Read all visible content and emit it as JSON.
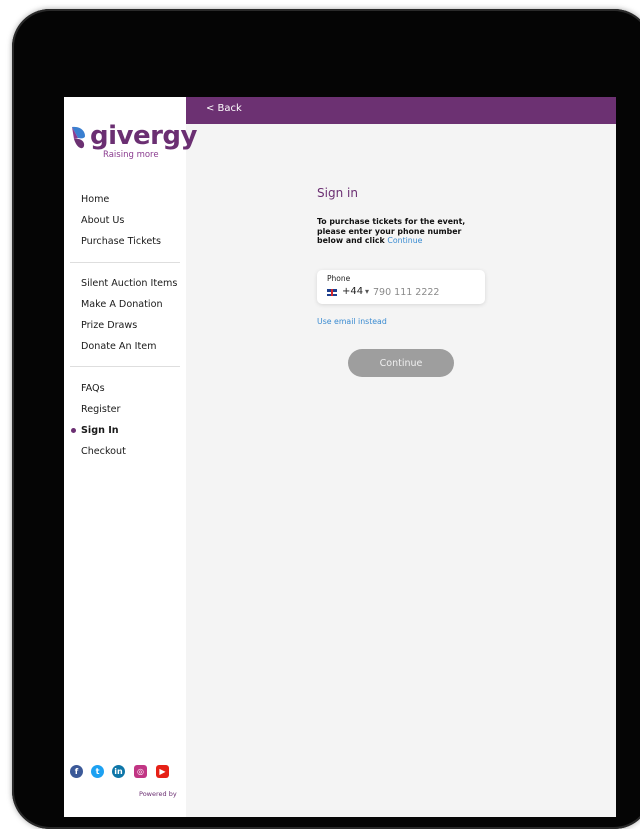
{
  "brand": {
    "name": "givergy",
    "tagline": "Raising more",
    "purple": "#6c3172",
    "logo_blue": "#3a7fd0"
  },
  "topbar": {
    "back_label": "< Back"
  },
  "sidebar": {
    "groups": [
      [
        "Home",
        "About Us",
        "Purchase Tickets"
      ],
      [
        "Silent Auction Items",
        "Make A Donation",
        "Prize Draws",
        "Donate An Item"
      ],
      [
        "FAQs",
        "Register",
        "Sign In",
        "Checkout"
      ]
    ],
    "active_item": "Sign In",
    "social_icons": [
      "facebook-icon",
      "twitter-icon",
      "linkedin-icon",
      "instagram-icon",
      "youtube-icon"
    ],
    "powered_by": "Powered by"
  },
  "signin": {
    "title": "Sign in",
    "instruction": "To purchase tickets for the event, please enter your phone number below and click",
    "instruction_link": "Continue",
    "phone_label": "Phone",
    "country_code": "+44",
    "phone_placeholder": "790 111 2222",
    "email_link": "Use email instead",
    "continue_label": "Continue"
  }
}
